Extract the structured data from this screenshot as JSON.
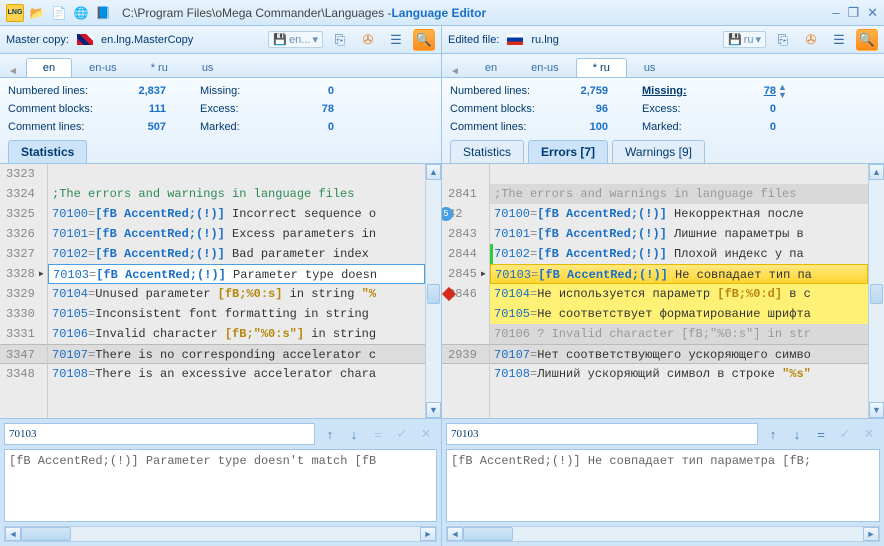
{
  "title": {
    "path": "C:\\Program Files\\oMega Commander\\Languages - ",
    "app": "Language Editor"
  },
  "winbtns": {
    "min": "‒",
    "max": "❐",
    "close": "✕"
  },
  "titlebar_icons": [
    "logo",
    "open",
    "save",
    "globe",
    "help"
  ],
  "left": {
    "toolbar": {
      "label": "Master copy:",
      "flag": "uk",
      "file": "en.lng.MasterCopy",
      "box": "en..."
    },
    "lang_tabs": [
      "en",
      "en-us",
      "* ru",
      "us"
    ],
    "active_lang_tab": 0,
    "stats": {
      "r1l": "Numbered lines:",
      "r1v": "2,837",
      "r1l2": "Missing:",
      "r1v2": "0",
      "r2l": "Comment blocks:",
      "r2v": "111",
      "r2l2": "Excess:",
      "r2v2": "78",
      "r3l": "Comment lines:",
      "r3v": "507",
      "r3l2": "Marked:",
      "r3v2": "0"
    },
    "sub_tabs": [
      "Statistics"
    ],
    "lines": [
      {
        "n": "3323",
        "type": "blank",
        "text": ""
      },
      {
        "n": "3324",
        "type": "comment",
        "text": ";The errors and warnings in language files"
      },
      {
        "n": "3325",
        "type": "code",
        "id": "70100",
        "fb": "[fB AccentRed;(!)]",
        "txt": " Incorrect sequence o"
      },
      {
        "n": "3326",
        "type": "code",
        "id": "70101",
        "fb": "[fB AccentRed;(!)]",
        "txt": " Excess parameters in"
      },
      {
        "n": "3327",
        "type": "code",
        "id": "70102",
        "fb": "[fB AccentRed;(!)]",
        "txt": " Bad parameter index "
      },
      {
        "n": "3328",
        "type": "code",
        "id": "70103",
        "fb": "[fB AccentRed;(!)]",
        "txt": " Parameter type doesn",
        "sel": "left",
        "mark": true
      },
      {
        "n": "3329",
        "type": "code",
        "id": "70104",
        "txt2": "Unused parameter ",
        "fmt": "[fB;%0:s]",
        "txt3": " in string ",
        "fmt2": "\"%"
      },
      {
        "n": "3330",
        "type": "code",
        "id": "70105",
        "txt2": "Inconsistent font formatting in string"
      },
      {
        "n": "3331",
        "type": "code",
        "id": "70106",
        "txt2": "Invalid character ",
        "fmt": "[fB;\"%0:s\"]",
        "txt3": " in string"
      },
      {
        "n": "3347",
        "type": "code",
        "id": "70107",
        "txt2": "There is no corresponding accelerator c",
        "gap": true
      },
      {
        "n": "3348",
        "type": "code",
        "id": "70108",
        "txt2": "There is an excessive accelerator chara"
      }
    ],
    "edit": {
      "id": "70103",
      "text": "[fB AccentRed;(!)] Parameter type doesn't match [fB"
    }
  },
  "right": {
    "toolbar": {
      "label": "Edited file:",
      "flag": "ru",
      "file": "ru.lng",
      "box": "ru"
    },
    "lang_tabs": [
      "en",
      "en-us",
      "* ru",
      "us"
    ],
    "active_lang_tab": 2,
    "stats": {
      "r1l": "Numbered lines:",
      "r1v": "2,759",
      "r1l2": "Missing:",
      "r1v2": "78",
      "r2l": "Comment blocks:",
      "r2v": "96",
      "r2l2": "Excess:",
      "r2v2": "0",
      "r3l": "Comment lines:",
      "r3v": "100",
      "r3l2": "Marked:",
      "r3v2": "0",
      "missing_link": true
    },
    "sub_tabs": [
      "Statistics",
      "Errors [7]",
      "Warnings [9]"
    ],
    "active_sub_tab": 1,
    "lines": [
      {
        "n": "",
        "type": "blank",
        "text": ""
      },
      {
        "n": "2841",
        "type": "comment",
        "text": ";The errors and warnings in language files",
        "gray": true
      },
      {
        "n": "42",
        "type": "code",
        "id": "70100",
        "fb": "[fB AccentRed;(!)]",
        "txt": " Некорректная после",
        "badge5": true
      },
      {
        "n": "2843",
        "type": "code",
        "id": "70101",
        "fb": "[fB AccentRed;(!)]",
        "txt": " Лишние параметры в "
      },
      {
        "n": "2844",
        "type": "code",
        "id": "70102",
        "fb": "[fB AccentRed;(!)]",
        "txt": " Плохой индекс у па",
        "grn": true
      },
      {
        "n": "2845",
        "type": "code",
        "id": "70103",
        "fb": "[fB AccentRed;(!)]",
        "txt": " Не совпадает тип па",
        "sel": "right",
        "mark": true
      },
      {
        "n": "2846",
        "type": "code",
        "id": "70104",
        "txt2": "Не используется параметр ",
        "fmt": "[fB;%0:d]",
        "txt3": " в с",
        "hl": true,
        "diamond": true
      },
      {
        "n": "",
        "type": "code",
        "id": "70105",
        "txt2": "Не соответствует форматирование шрифта",
        "hl": true
      },
      {
        "n": "",
        "type": "gray",
        "txt": "70106 ? Invalid character [fB;\"%0:s\"] in str"
      },
      {
        "n": "2939",
        "type": "code",
        "id": "70107",
        "txt2": "Нет соответствующего ускоряющего симво",
        "gap": true
      },
      {
        "n": "",
        "type": "code",
        "id": "70108",
        "txt2": "Лишний ускоряющий символ в строке ",
        "fmt": "\"%s\""
      }
    ],
    "edit": {
      "id": "70103",
      "text": "[fB AccentRed;(!)] Не совпадает тип параметра [fB;"
    }
  },
  "edit_btns": {
    "up": "↑",
    "down": "↓",
    "eq": "=",
    "ok": "✓",
    "cancel": "✕"
  },
  "tool_icons": {
    "copy": "⎘",
    "run": "✇",
    "list": "☰",
    "find": "🔍",
    "save": "💾",
    "dd": "▾"
  }
}
